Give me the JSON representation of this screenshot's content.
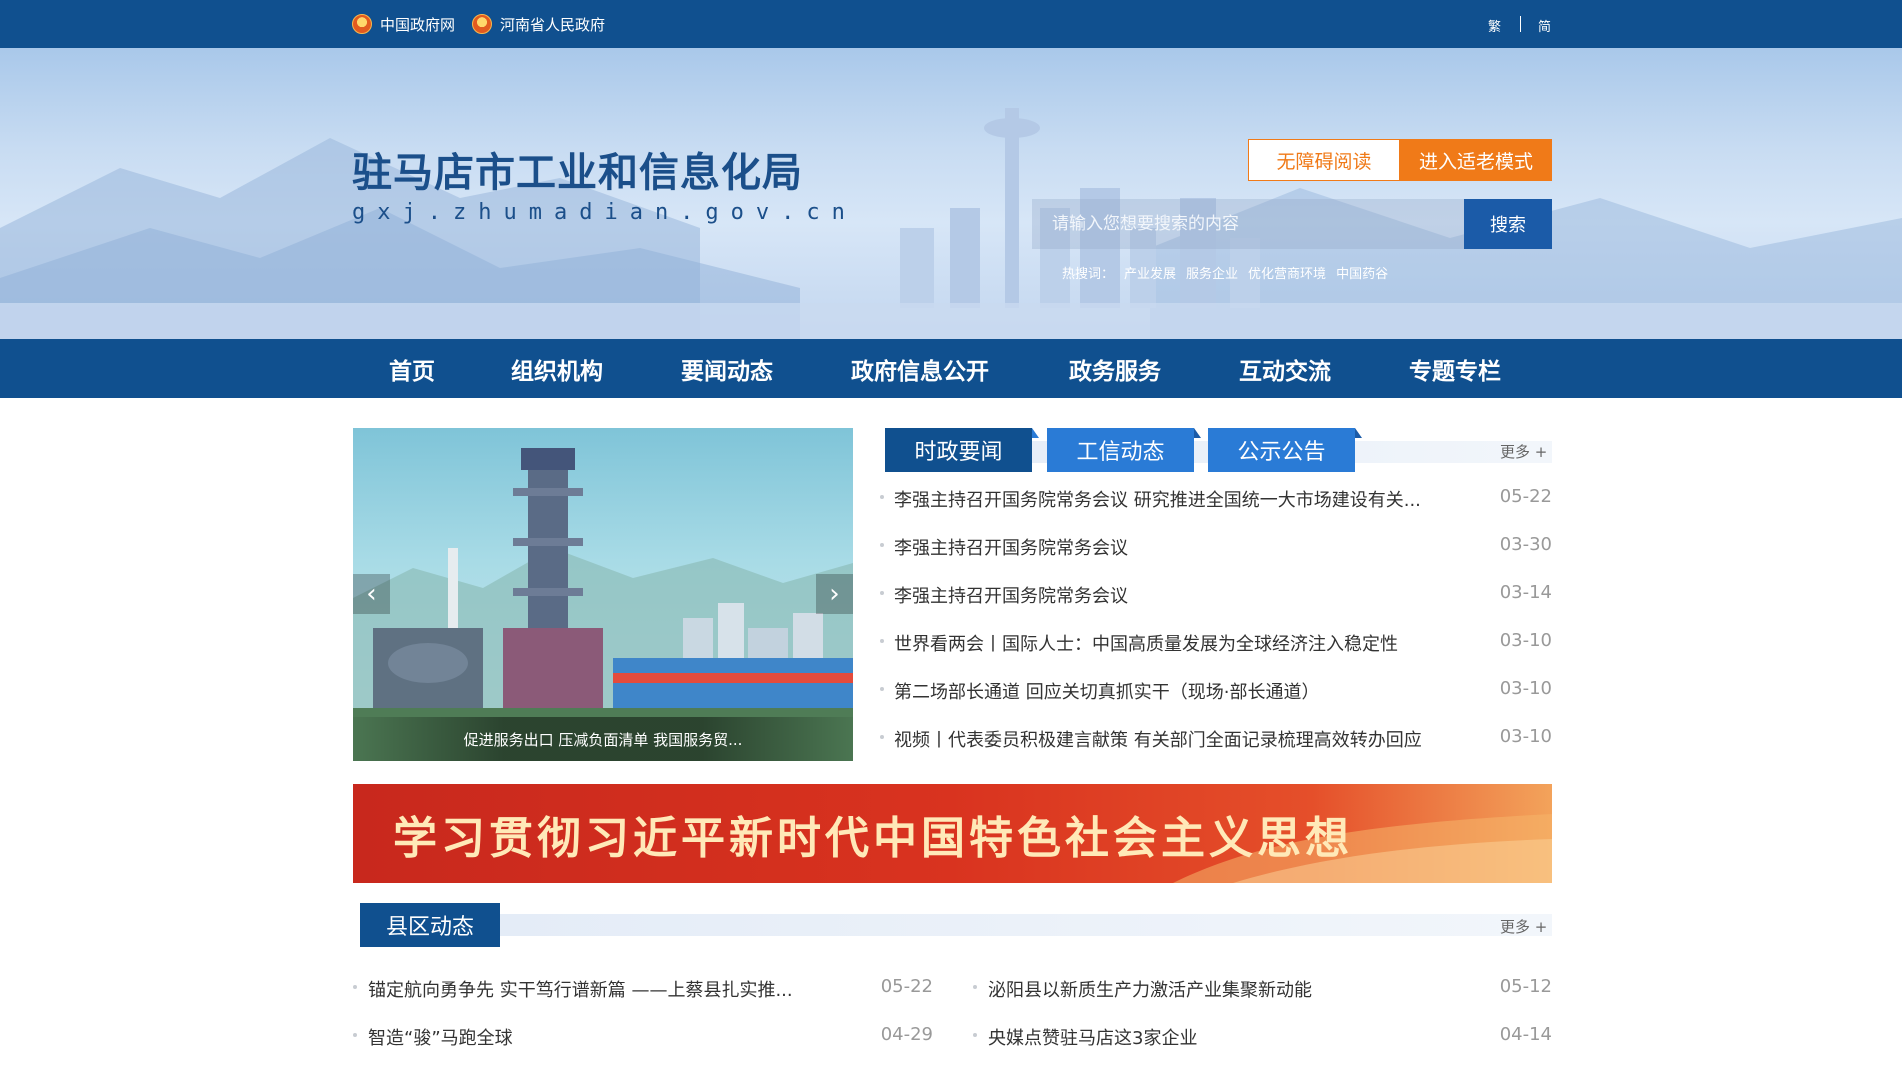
{
  "topbar": {
    "links": [
      {
        "label": "中国政府网",
        "icon": "national-emblem-icon"
      },
      {
        "label": "河南省人民政府",
        "icon": "national-emblem-icon"
      }
    ],
    "lang_traditional": "繁",
    "lang_simplified": "简"
  },
  "header": {
    "title": "驻马店市工业和信息化局",
    "domain": "gxj.zhumadian.gov.cn",
    "accessibility_button": "无障碍阅读",
    "elder_mode_button": "进入适老模式",
    "search": {
      "placeholder": "请输入您想要搜索的内容",
      "button": "搜索",
      "hot_label": "热搜词：",
      "hot_terms": [
        "产业发展",
        "服务企业",
        "优化营商环境",
        "中国药谷"
      ]
    }
  },
  "nav": {
    "items": [
      "首页",
      "组织机构",
      "要闻动态",
      "政府信息公开",
      "政务服务",
      "互动交流",
      "专题专栏"
    ]
  },
  "slider": {
    "caption": "促进服务出口 压减负面清单 我国服务贸...",
    "prev_icon": "chevron-left-icon",
    "next_icon": "chevron-right-icon"
  },
  "news": {
    "tabs": [
      "时政要闻",
      "工信动态",
      "公示公告"
    ],
    "active_tab": 0,
    "more": "更多 +",
    "items": [
      {
        "title": "李强主持召开国务院常务会议 研究推进全国统一大市场建设有关...",
        "date": "05-22"
      },
      {
        "title": "李强主持召开国务院常务会议",
        "date": "03-30"
      },
      {
        "title": "李强主持召开国务院常务会议",
        "date": "03-14"
      },
      {
        "title": "世界看两会丨国际人士：中国高质量发展为全球经济注入稳定性",
        "date": "03-10"
      },
      {
        "title": "第二场部长通道 回应关切真抓实干（现场·部长通道）",
        "date": "03-10"
      },
      {
        "title": "视频丨代表委员积极建言献策 有关部门全面记录梳理高效转办回应",
        "date": "03-10"
      }
    ]
  },
  "party_banner": {
    "text": "学习贯彻习近平新时代中国特色社会主义思想"
  },
  "county": {
    "tab": "县区动态",
    "more": "更多 +",
    "left": [
      {
        "title": "锚定航向勇争先 实干笃行谱新篇 ——上蔡县扎实推...",
        "date": "05-22"
      },
      {
        "title": "智造“骏”马跑全球",
        "date": "04-29"
      }
    ],
    "right": [
      {
        "title": "泌阳县以新质生产力激活产业集聚新动能",
        "date": "05-12"
      },
      {
        "title": "央媒点赞驻马店这3家企业",
        "date": "04-14"
      }
    ]
  },
  "colors": {
    "primary_blue": "#10508f",
    "accent_orange": "#f07a18",
    "tab_blue": "#2a7bd6",
    "banner_red": "#d9331f"
  }
}
